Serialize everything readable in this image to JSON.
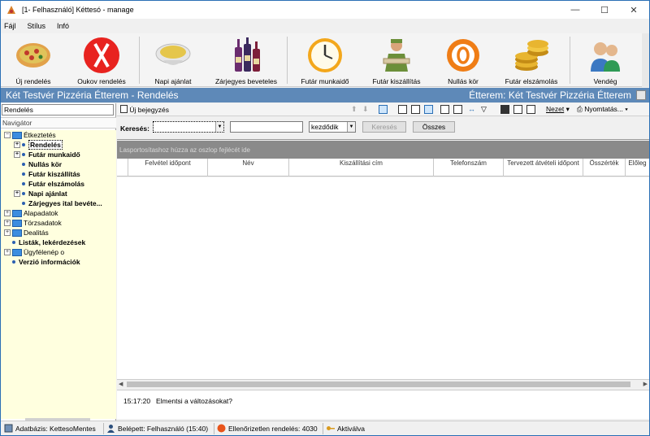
{
  "window": {
    "title": "[1- Felhasználó] Kéttesó - manage",
    "controls": [
      "—",
      "☐",
      "✕"
    ]
  },
  "menu": [
    "Fájl",
    "Stílus",
    "Infó"
  ],
  "toolbar": [
    {
      "label": "Új rendelés",
      "icon": "pizza-icon"
    },
    {
      "label": "Oukov rendelés",
      "icon": "fork-knife-icon"
    },
    {
      "label": "Napi ajánlat",
      "icon": "soup-bowl-icon"
    },
    {
      "label": "Zárjegyes beveteles",
      "icon": "wine-bottles-icon"
    },
    {
      "label": "Futár munkaidő",
      "icon": "clock-icon"
    },
    {
      "label": "Futár kiszállítás",
      "icon": "delivery-man-icon"
    },
    {
      "label": "Nullás kör",
      "icon": "zero-icon"
    },
    {
      "label": "Futár elszámolás",
      "icon": "coins-icon"
    },
    {
      "label": "Vendég",
      "icon": "users-icon"
    }
  ],
  "header": {
    "left": "Két Testvér Pizzéria Étterem - Rendelés",
    "right": "Étterem:  Két Testvér Pizzéria Étterem"
  },
  "navigator": {
    "search_value": "Rendelés",
    "title": "Navigátor",
    "tree": [
      {
        "label": "Étkeztetés",
        "type": "folder",
        "exp": "−"
      },
      {
        "label": "Rendelés",
        "type": "item",
        "exp": "+",
        "bold": true,
        "selected": true
      },
      {
        "label": "Futár munkaidő",
        "type": "item",
        "exp": "+",
        "bold": true
      },
      {
        "label": "Nullás kör",
        "type": "item",
        "bold": true
      },
      {
        "label": "Futár kiszállítás",
        "type": "item",
        "bold": true
      },
      {
        "label": "Futár elszámolás",
        "type": "item",
        "bold": true
      },
      {
        "label": "Napi ajánlat",
        "type": "item",
        "exp": "+",
        "bold": true
      },
      {
        "label": "Zárjegyes ital bevéte...",
        "type": "item",
        "bold": true
      },
      {
        "label": "Alapadatok",
        "type": "folder",
        "exp": "+"
      },
      {
        "label": "Törzsadatok",
        "type": "folder",
        "exp": "+"
      },
      {
        "label": "Dealitás",
        "type": "folder",
        "exp": "+"
      },
      {
        "label": "Listák, lekérdezések",
        "type": "item",
        "bold": true
      },
      {
        "label": "Ügyfélenép o",
        "type": "folder",
        "exp": "+"
      },
      {
        "label": "Verzió információk",
        "type": "item",
        "bold": true
      }
    ]
  },
  "subtoolbar": {
    "new_record": "Új bejegyzés",
    "view": "Nezet",
    "printing": "Nyomtatás..."
  },
  "search": {
    "label": "Keresés:",
    "field1": "",
    "field2": "",
    "mode": "kezdődik",
    "search_button": "Keresés",
    "all_button": "Összes"
  },
  "group_hint": "Lasportosítashoz húzza az oszlop fejlécét ide",
  "columns": [
    "Felvétel időpont",
    "Név",
    "Kiszállítási cím",
    "Telefonszám",
    "Tervezett átvételi időpont",
    "Összérték",
    "Előleg"
  ],
  "log": {
    "time": "15:17:20",
    "message": "Elmentsi a változásokat?"
  },
  "status": [
    {
      "text": "Adatbázis: KettesoMentes",
      "icon": "database-icon"
    },
    {
      "text": "Belépett: Felhasználó (15:40)",
      "icon": "user-icon"
    },
    {
      "text": "Ellenőrizetlen rendelés: 4030",
      "icon": "warning-icon"
    },
    {
      "text": "Aktiválva",
      "icon": "key-icon"
    }
  ]
}
